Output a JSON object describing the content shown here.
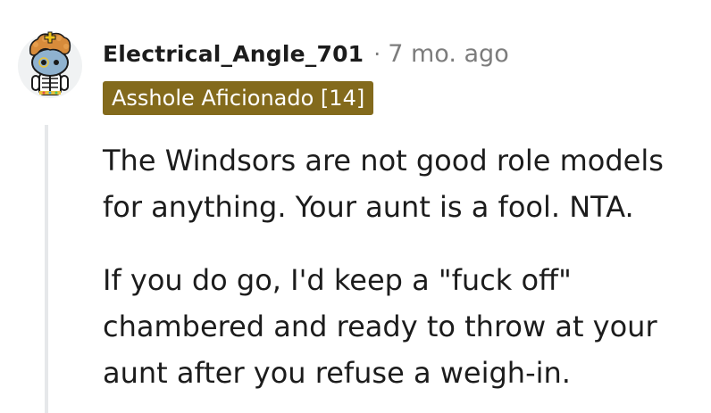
{
  "comment": {
    "author": "Electrical_Angle_701",
    "separator": "·",
    "timestamp": "7 mo. ago",
    "flair": "Asshole Aficionado [14]",
    "paragraphs": [
      "The Windsors are not good role models for anything. Your aunt is a fool. NTA.",
      "If you do go, I'd keep a \"fuck off\" chambered and ready to throw at your aunt after you refuse a weigh-in."
    ]
  },
  "colors": {
    "flair_background": "#836a1c",
    "flair_text": "#ffffff",
    "meta_text": "#7c7c7c",
    "thread_line": "#e6e8ea"
  },
  "avatar": {
    "icon": "snoo-skeleton-avatar-icon"
  }
}
